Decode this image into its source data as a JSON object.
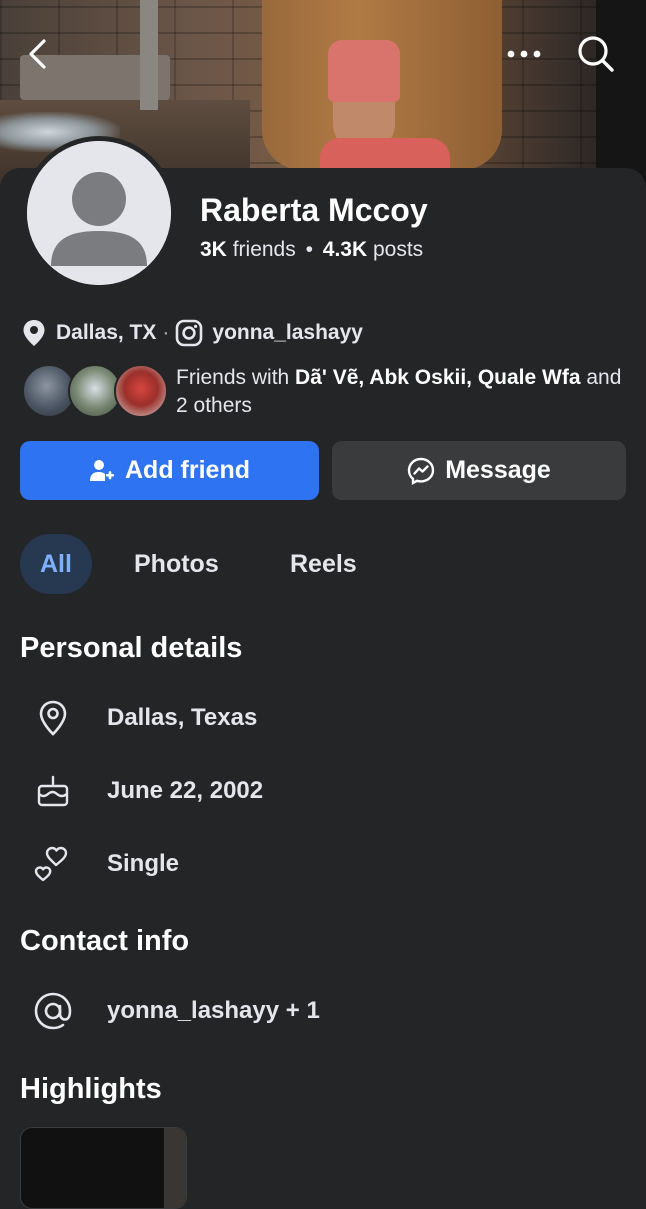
{
  "header": {
    "back_icon": "chevron-left-icon",
    "more_icon": "ellipsis-icon",
    "search_icon": "search-icon"
  },
  "profile": {
    "name": "Raberta Mccoy",
    "friends_count": "3K",
    "friends_label": "friends",
    "separator": "•",
    "posts_count": "4.3K",
    "posts_label": "posts",
    "location": "Dallas, TX",
    "dot": "·",
    "instagram": "yonna_lashayy"
  },
  "mutual": {
    "prefix": "Friends with ",
    "names": "Dã' Vẽ, Abk Oskii, Quale Wfa",
    "suffix": " and 2 others"
  },
  "actions": {
    "add_friend": "Add friend",
    "message": "Message"
  },
  "tabs": [
    {
      "label": "All",
      "active": true
    },
    {
      "label": "Photos",
      "active": false
    },
    {
      "label": "Reels",
      "active": false
    }
  ],
  "personal_details": {
    "title": "Personal details",
    "items": [
      {
        "icon": "map-pin-icon",
        "text": "Dallas, Texas"
      },
      {
        "icon": "birthday-cake-icon",
        "text": "June 22, 2002"
      },
      {
        "icon": "hearts-icon",
        "text": "Single"
      }
    ]
  },
  "contact_info": {
    "title": "Contact info",
    "items": [
      {
        "icon": "at-sign-icon",
        "text": "yonna_lashayy + 1"
      }
    ]
  },
  "highlights": {
    "title": "Highlights"
  },
  "colors": {
    "background": "#242527",
    "primary_button": "#2d73f2",
    "secondary_button": "#3a3b3c",
    "active_tab_bg": "#263951",
    "active_tab_text": "#7fb0ff"
  }
}
